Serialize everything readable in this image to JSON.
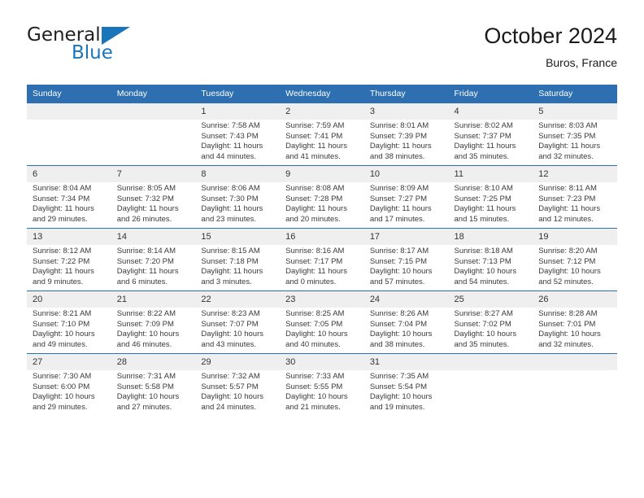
{
  "brand": {
    "name_part1": "General",
    "name_part2": "Blue",
    "logo_icon": "triangle-flag-icon"
  },
  "header": {
    "title": "October 2024",
    "subtitle": "Buros, France"
  },
  "colors": {
    "header_blue": "#2d6fb0",
    "brand_blue": "#1b75bb",
    "daynum_bg": "#efefef",
    "text": "#3a3a3a"
  },
  "weekday_headers": [
    "Sunday",
    "Monday",
    "Tuesday",
    "Wednesday",
    "Thursday",
    "Friday",
    "Saturday"
  ],
  "weeks": [
    [
      {
        "day": "",
        "sunrise": "",
        "sunset": "",
        "daylight1": "",
        "daylight2": ""
      },
      {
        "day": "",
        "sunrise": "",
        "sunset": "",
        "daylight1": "",
        "daylight2": ""
      },
      {
        "day": "1",
        "sunrise": "Sunrise: 7:58 AM",
        "sunset": "Sunset: 7:43 PM",
        "daylight1": "Daylight: 11 hours",
        "daylight2": "and 44 minutes."
      },
      {
        "day": "2",
        "sunrise": "Sunrise: 7:59 AM",
        "sunset": "Sunset: 7:41 PM",
        "daylight1": "Daylight: 11 hours",
        "daylight2": "and 41 minutes."
      },
      {
        "day": "3",
        "sunrise": "Sunrise: 8:01 AM",
        "sunset": "Sunset: 7:39 PM",
        "daylight1": "Daylight: 11 hours",
        "daylight2": "and 38 minutes."
      },
      {
        "day": "4",
        "sunrise": "Sunrise: 8:02 AM",
        "sunset": "Sunset: 7:37 PM",
        "daylight1": "Daylight: 11 hours",
        "daylight2": "and 35 minutes."
      },
      {
        "day": "5",
        "sunrise": "Sunrise: 8:03 AM",
        "sunset": "Sunset: 7:35 PM",
        "daylight1": "Daylight: 11 hours",
        "daylight2": "and 32 minutes."
      }
    ],
    [
      {
        "day": "6",
        "sunrise": "Sunrise: 8:04 AM",
        "sunset": "Sunset: 7:34 PM",
        "daylight1": "Daylight: 11 hours",
        "daylight2": "and 29 minutes."
      },
      {
        "day": "7",
        "sunrise": "Sunrise: 8:05 AM",
        "sunset": "Sunset: 7:32 PM",
        "daylight1": "Daylight: 11 hours",
        "daylight2": "and 26 minutes."
      },
      {
        "day": "8",
        "sunrise": "Sunrise: 8:06 AM",
        "sunset": "Sunset: 7:30 PM",
        "daylight1": "Daylight: 11 hours",
        "daylight2": "and 23 minutes."
      },
      {
        "day": "9",
        "sunrise": "Sunrise: 8:08 AM",
        "sunset": "Sunset: 7:28 PM",
        "daylight1": "Daylight: 11 hours",
        "daylight2": "and 20 minutes."
      },
      {
        "day": "10",
        "sunrise": "Sunrise: 8:09 AM",
        "sunset": "Sunset: 7:27 PM",
        "daylight1": "Daylight: 11 hours",
        "daylight2": "and 17 minutes."
      },
      {
        "day": "11",
        "sunrise": "Sunrise: 8:10 AM",
        "sunset": "Sunset: 7:25 PM",
        "daylight1": "Daylight: 11 hours",
        "daylight2": "and 15 minutes."
      },
      {
        "day": "12",
        "sunrise": "Sunrise: 8:11 AM",
        "sunset": "Sunset: 7:23 PM",
        "daylight1": "Daylight: 11 hours",
        "daylight2": "and 12 minutes."
      }
    ],
    [
      {
        "day": "13",
        "sunrise": "Sunrise: 8:12 AM",
        "sunset": "Sunset: 7:22 PM",
        "daylight1": "Daylight: 11 hours",
        "daylight2": "and 9 minutes."
      },
      {
        "day": "14",
        "sunrise": "Sunrise: 8:14 AM",
        "sunset": "Sunset: 7:20 PM",
        "daylight1": "Daylight: 11 hours",
        "daylight2": "and 6 minutes."
      },
      {
        "day": "15",
        "sunrise": "Sunrise: 8:15 AM",
        "sunset": "Sunset: 7:18 PM",
        "daylight1": "Daylight: 11 hours",
        "daylight2": "and 3 minutes."
      },
      {
        "day": "16",
        "sunrise": "Sunrise: 8:16 AM",
        "sunset": "Sunset: 7:17 PM",
        "daylight1": "Daylight: 11 hours",
        "daylight2": "and 0 minutes."
      },
      {
        "day": "17",
        "sunrise": "Sunrise: 8:17 AM",
        "sunset": "Sunset: 7:15 PM",
        "daylight1": "Daylight: 10 hours",
        "daylight2": "and 57 minutes."
      },
      {
        "day": "18",
        "sunrise": "Sunrise: 8:18 AM",
        "sunset": "Sunset: 7:13 PM",
        "daylight1": "Daylight: 10 hours",
        "daylight2": "and 54 minutes."
      },
      {
        "day": "19",
        "sunrise": "Sunrise: 8:20 AM",
        "sunset": "Sunset: 7:12 PM",
        "daylight1": "Daylight: 10 hours",
        "daylight2": "and 52 minutes."
      }
    ],
    [
      {
        "day": "20",
        "sunrise": "Sunrise: 8:21 AM",
        "sunset": "Sunset: 7:10 PM",
        "daylight1": "Daylight: 10 hours",
        "daylight2": "and 49 minutes."
      },
      {
        "day": "21",
        "sunrise": "Sunrise: 8:22 AM",
        "sunset": "Sunset: 7:09 PM",
        "daylight1": "Daylight: 10 hours",
        "daylight2": "and 46 minutes."
      },
      {
        "day": "22",
        "sunrise": "Sunrise: 8:23 AM",
        "sunset": "Sunset: 7:07 PM",
        "daylight1": "Daylight: 10 hours",
        "daylight2": "and 43 minutes."
      },
      {
        "day": "23",
        "sunrise": "Sunrise: 8:25 AM",
        "sunset": "Sunset: 7:05 PM",
        "daylight1": "Daylight: 10 hours",
        "daylight2": "and 40 minutes."
      },
      {
        "day": "24",
        "sunrise": "Sunrise: 8:26 AM",
        "sunset": "Sunset: 7:04 PM",
        "daylight1": "Daylight: 10 hours",
        "daylight2": "and 38 minutes."
      },
      {
        "day": "25",
        "sunrise": "Sunrise: 8:27 AM",
        "sunset": "Sunset: 7:02 PM",
        "daylight1": "Daylight: 10 hours",
        "daylight2": "and 35 minutes."
      },
      {
        "day": "26",
        "sunrise": "Sunrise: 8:28 AM",
        "sunset": "Sunset: 7:01 PM",
        "daylight1": "Daylight: 10 hours",
        "daylight2": "and 32 minutes."
      }
    ],
    [
      {
        "day": "27",
        "sunrise": "Sunrise: 7:30 AM",
        "sunset": "Sunset: 6:00 PM",
        "daylight1": "Daylight: 10 hours",
        "daylight2": "and 29 minutes."
      },
      {
        "day": "28",
        "sunrise": "Sunrise: 7:31 AM",
        "sunset": "Sunset: 5:58 PM",
        "daylight1": "Daylight: 10 hours",
        "daylight2": "and 27 minutes."
      },
      {
        "day": "29",
        "sunrise": "Sunrise: 7:32 AM",
        "sunset": "Sunset: 5:57 PM",
        "daylight1": "Daylight: 10 hours",
        "daylight2": "and 24 minutes."
      },
      {
        "day": "30",
        "sunrise": "Sunrise: 7:33 AM",
        "sunset": "Sunset: 5:55 PM",
        "daylight1": "Daylight: 10 hours",
        "daylight2": "and 21 minutes."
      },
      {
        "day": "31",
        "sunrise": "Sunrise: 7:35 AM",
        "sunset": "Sunset: 5:54 PM",
        "daylight1": "Daylight: 10 hours",
        "daylight2": "and 19 minutes."
      },
      {
        "day": "",
        "sunrise": "",
        "sunset": "",
        "daylight1": "",
        "daylight2": ""
      },
      {
        "day": "",
        "sunrise": "",
        "sunset": "",
        "daylight1": "",
        "daylight2": ""
      }
    ]
  ]
}
